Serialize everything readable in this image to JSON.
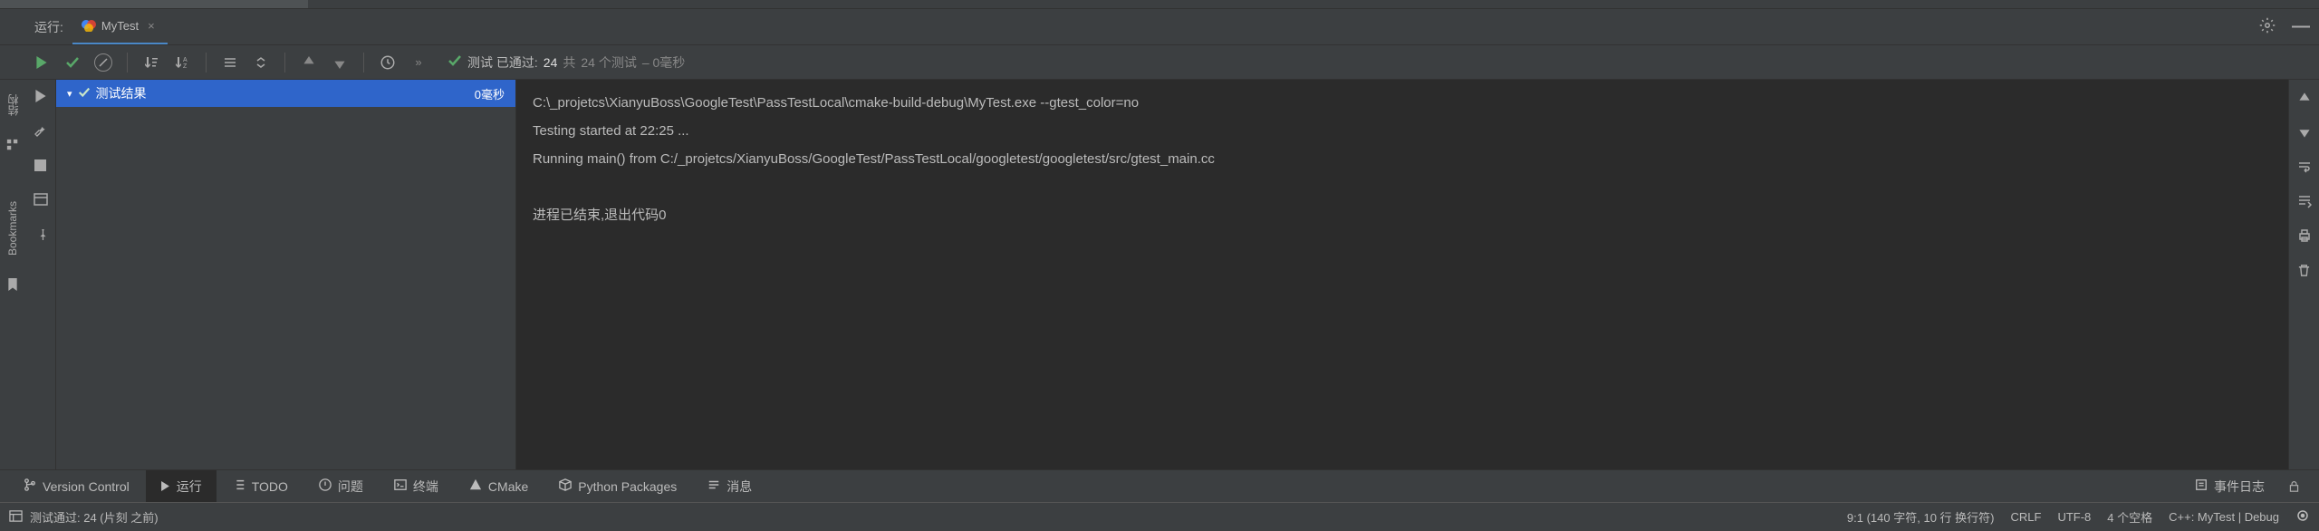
{
  "tabRow": {
    "runLabel": "运行:",
    "tabName": "MyTest"
  },
  "toolbar": {
    "statusPrefix": "测试 已通过:",
    "passed": "24",
    "sepWord": "共",
    "total": "24 个测试",
    "duration": "– 0毫秒"
  },
  "tree": {
    "rootLabel": "测试结果",
    "rootTime": "0毫秒"
  },
  "console": {
    "line1": "C:\\_projetcs\\XianyuBoss\\GoogleTest\\PassTestLocal\\cmake-build-debug\\MyTest.exe --gtest_color=no",
    "line2": "Testing started at 22:25 ...",
    "line3": "Running main() from C:/_projetcs/XianyuBoss/GoogleTest/PassTestLocal/googletest/googletest/src/gtest_main.cc",
    "line4": "",
    "line5": "进程已结束,退出代码0"
  },
  "leftSide": {
    "structure": "结构",
    "bookmarks": "Bookmarks"
  },
  "bottomTabs": {
    "vcs": "Version Control",
    "run": "运行",
    "todo": "TODO",
    "problems": "问题",
    "terminal": "终端",
    "cmake": "CMake",
    "python": "Python Packages",
    "messages": "消息",
    "eventLog": "事件日志"
  },
  "statusBar": {
    "left": "测试通过: 24 (片刻 之前)",
    "cursor": "9:1 (140 字符, 10 行 换行符)",
    "lineEnd": "CRLF",
    "encoding": "UTF-8",
    "indent": "4 个空格",
    "config": "C++: MyTest | Debug"
  }
}
